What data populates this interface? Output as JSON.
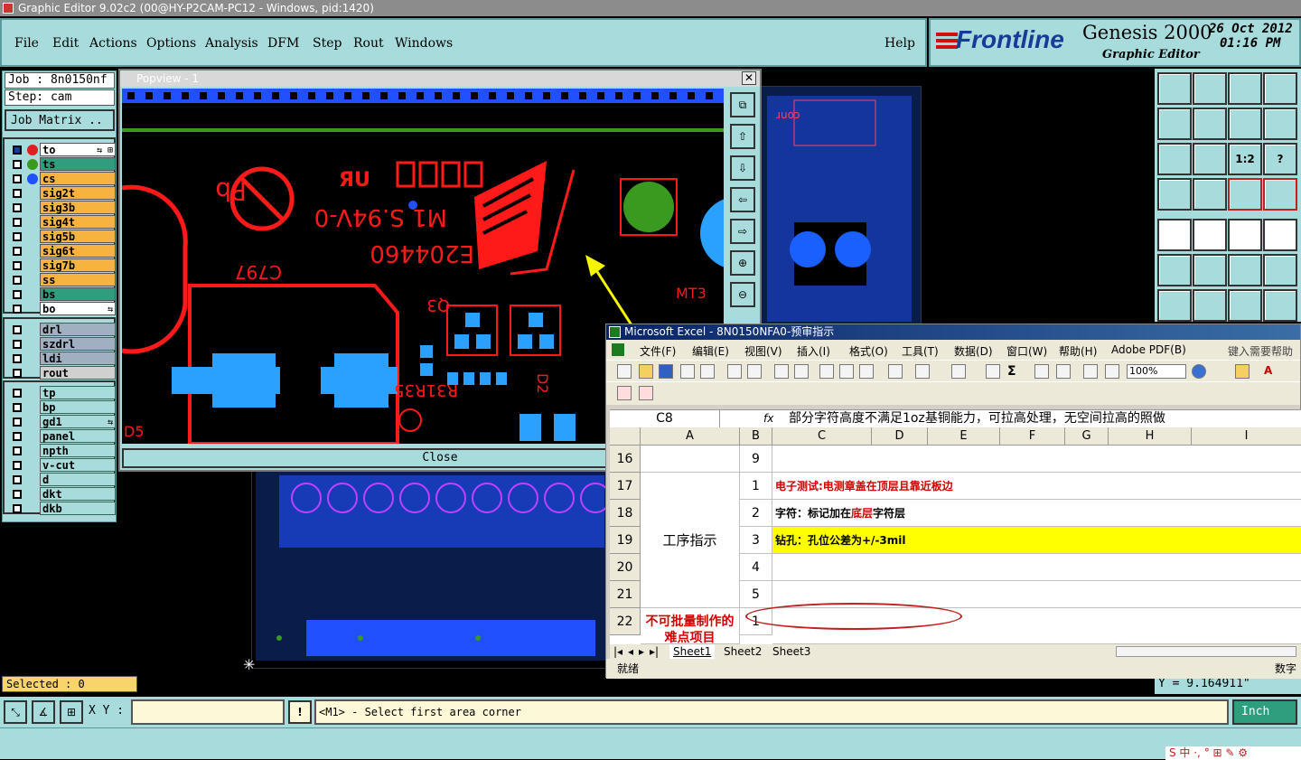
{
  "window": {
    "title": "Graphic Editor 9.02c2 (00@HY-P2CAM-PC12 - Windows, pid:1420)"
  },
  "menu": {
    "items": [
      "File",
      "Edit",
      "Actions",
      "Options",
      "Analysis",
      "DFM",
      "Step",
      "Rout",
      "Windows"
    ],
    "help": "Help"
  },
  "brand": {
    "logo": "Frontline",
    "product": "Genesis 2000",
    "subtitle": "Graphic Editor",
    "date": "26 Oct 2012",
    "time": "01:16 PM"
  },
  "job": {
    "label": "Job : 8n0150nf",
    "step": "Step: cam",
    "matrix_button": "Job Matrix .."
  },
  "layers_group1": [
    {
      "name": "to",
      "color": "#ffffff",
      "dot": "#e02020",
      "extra": "⇆ ⊞"
    },
    {
      "name": "ts",
      "color": "#2e9e7e",
      "dot": "#3a9a20",
      "extra": ""
    },
    {
      "name": "cs",
      "color": "#f7b340",
      "dot": "#2050ff",
      "extra": ""
    },
    {
      "name": "sig2t",
      "color": "#f7b340",
      "dot": "",
      "extra": ""
    },
    {
      "name": "sig3b",
      "color": "#f7b340",
      "dot": "",
      "extra": ""
    },
    {
      "name": "sig4t",
      "color": "#f7b340",
      "dot": "",
      "extra": ""
    },
    {
      "name": "sig5b",
      "color": "#f7b340",
      "dot": "",
      "extra": ""
    },
    {
      "name": "sig6t",
      "color": "#f7b340",
      "dot": "",
      "extra": ""
    },
    {
      "name": "sig7b",
      "color": "#f7b340",
      "dot": "",
      "extra": ""
    },
    {
      "name": "ss",
      "color": "#f7b340",
      "dot": "",
      "extra": ""
    },
    {
      "name": "bs",
      "color": "#2e9e7e",
      "dot": "",
      "extra": ""
    },
    {
      "name": "bo",
      "color": "#ffffff",
      "dot": "",
      "extra": "⇆"
    }
  ],
  "layers_group2": [
    {
      "name": "drl",
      "color": "#a0b0c0",
      "extra": ""
    },
    {
      "name": "szdrl",
      "color": "#a0b0c0",
      "extra": ""
    },
    {
      "name": "ldi",
      "color": "#a0b0c0",
      "extra": ""
    },
    {
      "name": "rout",
      "color": "#d0d0d0",
      "extra": ""
    }
  ],
  "layers_group3": [
    {
      "name": "tp",
      "color": "#a8dcdc",
      "extra": ""
    },
    {
      "name": "bp",
      "color": "#a8dcdc",
      "extra": ""
    },
    {
      "name": "gd1",
      "color": "#a8dcdc",
      "extra": "⇆"
    },
    {
      "name": "panel",
      "color": "#a8dcdc",
      "extra": ""
    },
    {
      "name": "npth",
      "color": "#a8dcdc",
      "extra": ""
    },
    {
      "name": "v-cut",
      "color": "#a8dcdc",
      "extra": ""
    },
    {
      "name": "d",
      "color": "#a8dcdc",
      "extra": ""
    },
    {
      "name": "dkt",
      "color": "#a8dcdc",
      "extra": ""
    },
    {
      "name": "dkb",
      "color": "#a8dcdc",
      "extra": ""
    }
  ],
  "selected": "Selected : 0",
  "coords": {
    "label": "X Y :",
    "value": "",
    "y_readout": "Y = 9.164911\""
  },
  "prompt": "<M1> - Select first area corner",
  "units": "Inch",
  "popview": {
    "title": "Popview - 1",
    "close": "Close",
    "board_text": [
      "E204460",
      "M1 S.94V-0",
      "C797",
      "MT3",
      "Q3",
      "R31R35",
      "D2",
      "D5"
    ]
  },
  "excel": {
    "title": "Microsoft Excel - 8N0150NFA0-预审指示",
    "menu": [
      "文件(F)",
      "编辑(E)",
      "视图(V)",
      "插入(I)",
      "格式(O)",
      "工具(T)",
      "数据(D)",
      "窗口(W)",
      "帮助(H)",
      "Adobe PDF(B)"
    ],
    "help_search": "键入需要帮助的",
    "zoom": "100%",
    "name_box": "C8",
    "formula": "部分字符高度不满足1oz基铜能力，可拉高处理，无空间拉高的照做",
    "columns": [
      "A",
      "B",
      "C",
      "D",
      "E",
      "F",
      "G",
      "H",
      "I"
    ],
    "rows": [
      {
        "num": "16",
        "b": "9",
        "c": ""
      },
      {
        "num": "17",
        "b": "1",
        "c": "电子测试:电测章盖在顶层且靠近板边"
      },
      {
        "num": "18",
        "b": "2",
        "c_pre": "字符：标记加在",
        "c_hl": "底层",
        "c_post": "字符层"
      },
      {
        "num": "19",
        "b": "3",
        "c": "钻孔：孔位公差为+/-3mil"
      },
      {
        "num": "20",
        "b": "4",
        "c": ""
      },
      {
        "num": "21",
        "b": "5",
        "c": ""
      },
      {
        "num": "22",
        "b": "1",
        "c": ""
      }
    ],
    "merged_a": "工序指示",
    "red_a": "不可批量制作的难点项目",
    "sheets": [
      "Sheet1",
      "Sheet2",
      "Sheet3"
    ],
    "status": "就绪",
    "status_right": "数字"
  },
  "taskbar": {
    "ime": "S 中 ·, ° ⊞ ✎ ⚙"
  }
}
